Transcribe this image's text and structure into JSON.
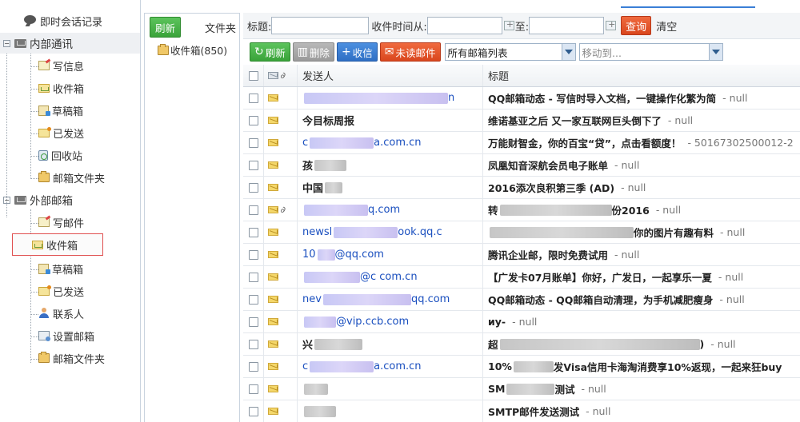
{
  "tree": {
    "chat_records": "即时会话记录",
    "internal_group": "内部通讯",
    "internal_items": [
      "写信息",
      "收件箱",
      "草稿箱",
      "已发送",
      "回收站",
      "邮箱文件夹"
    ],
    "external_group": "外部邮箱",
    "external_items": [
      "写邮件",
      "收件箱",
      "草稿箱",
      "已发送",
      "联系人",
      "设置邮箱",
      "邮箱文件夹"
    ],
    "expander_symbol": "−"
  },
  "folder_panel": {
    "refresh_label": "刷新",
    "title": "文件夹",
    "inbox_item": "收件箱(850)"
  },
  "search": {
    "subject_label": "标题:",
    "time_from_label": "收件时间从:",
    "to_label": "至:",
    "query_button": "查询",
    "clear_link": "清空"
  },
  "toolbar": {
    "refresh": "刷新",
    "delete": "删除",
    "receive": "收信",
    "unread": "未读邮件",
    "mailbox_select": "所有邮箱列表",
    "move_to_placeholder": "移动到..."
  },
  "grid": {
    "header": {
      "sender": "发送人",
      "subject": "标题"
    },
    "rows": [
      {
        "sender_start": "",
        "sender_end": "n",
        "subject": "QQ邮箱动态 - 写信时导入文档，一键操作化繁为简",
        "suffix": "- null",
        "attachment": false
      },
      {
        "sender_start": "今目标周报",
        "sender_end": "",
        "subject": "维诺基亚之后 又一家互联网巨头倒下了",
        "suffix": "- null",
        "attachment": false
      },
      {
        "sender_start": "c",
        "sender_end": "a.com.cn",
        "subject": "万能财智金，你的百宝“贷”，点击看额度！",
        "suffix": "- 50167302500012-2",
        "attachment": false
      },
      {
        "sender_start": "孩",
        "sender_end": "",
        "subject": "凤凰知音深航会员电子账单",
        "suffix": "- null",
        "attachment": false
      },
      {
        "sender_start": "中国",
        "sender_end": "",
        "subject": "2016添次良积第三季 (AD)",
        "suffix": "- null",
        "attachment": false
      },
      {
        "sender_start": "",
        "sender_end": "q.com",
        "subject": "转",
        "subject_end": "份2016",
        "suffix": "- null",
        "attachment": true
      },
      {
        "sender_start": "newsl",
        "sender_end": "ook.qq.c",
        "subject": "",
        "subject_end": "你的图片有趣有料",
        "suffix": "- null",
        "attachment": false
      },
      {
        "sender_start": "10",
        "sender_end": "@qq.com",
        "subject": "腾讯企业邮，限时免费试用",
        "suffix": "- null",
        "attachment": false
      },
      {
        "sender_start": "",
        "sender_end": "@c           com.cn",
        "subject": "【广发卡07月账单】你好，广发日，一起享乐一夏",
        "suffix": "- null",
        "attachment": false
      },
      {
        "sender_start": "nev",
        "sender_end": "qq.com",
        "subject": "QQ邮箱动态 - QQ邮箱自动清理，为手机减肥瘦身",
        "suffix": "- null",
        "attachment": false
      },
      {
        "sender_start": "",
        "sender_end": "@vip.ccb.com",
        "subject": "иу-",
        "suffix": "- null",
        "attachment": false
      },
      {
        "sender_start": "兴",
        "sender_end": "",
        "subject": "超",
        "subject_end": ")",
        "suffix": "- null",
        "attachment": false
      },
      {
        "sender_start": "c",
        "sender_end": "a.com.cn",
        "subject": "10%",
        "subject_end": "发Visa信用卡海淘消费享10%返现，一起来狂buy",
        "suffix": "",
        "attachment": false
      },
      {
        "sender_start": "",
        "sender_end": "",
        "subject": "SM",
        "subject_end": "测试",
        "suffix": "- null",
        "attachment": false
      },
      {
        "sender_start": "",
        "sender_end": "",
        "subject": "SMTP邮件发送测试",
        "suffix": "- null",
        "attachment": false
      }
    ]
  },
  "colors": {
    "accent_blue": "#3a7fd6",
    "selected_outline": "#e05050",
    "link": "#1a4fbf"
  }
}
